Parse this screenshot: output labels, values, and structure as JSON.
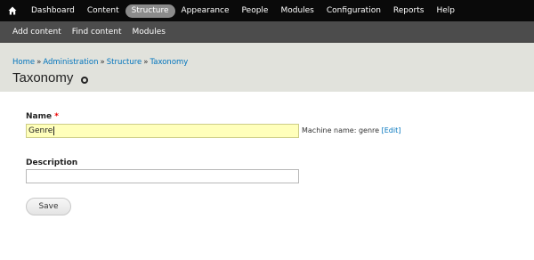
{
  "admin_menu": {
    "items": [
      {
        "label": "Dashboard"
      },
      {
        "label": "Content"
      },
      {
        "label": "Structure",
        "active": true
      },
      {
        "label": "Appearance"
      },
      {
        "label": "People"
      },
      {
        "label": "Modules"
      },
      {
        "label": "Configuration"
      },
      {
        "label": "Reports"
      },
      {
        "label": "Help"
      }
    ]
  },
  "shortcuts": {
    "items": [
      {
        "label": "Add content"
      },
      {
        "label": "Find content"
      },
      {
        "label": "Modules"
      }
    ]
  },
  "breadcrumb": {
    "items": [
      "Home",
      "Administration",
      "Structure",
      "Taxonomy"
    ],
    "separator": "»"
  },
  "page": {
    "title": "Taxonomy"
  },
  "form": {
    "name_label": "Name",
    "required_mark": "*",
    "name_value": "Genre",
    "machine_name_prefix": "Machine name: genre",
    "machine_name_edit": "[Edit]",
    "description_label": "Description",
    "description_value": "",
    "save_label": "Save"
  },
  "colors": {
    "admin_bar": "#0a0a0a",
    "shortcut_bar": "#4c4c4c",
    "header_bg": "#e1e2dc",
    "link": "#0074bd",
    "active_field": "#ffffbb",
    "required": "#ee0000"
  }
}
